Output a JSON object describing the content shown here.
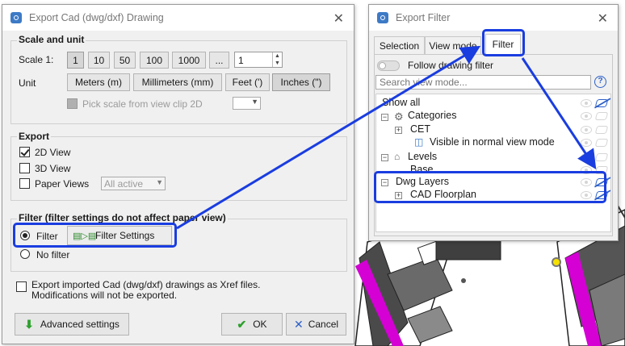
{
  "export_dialog": {
    "title": "Export Cad (dwg/dxf) Drawing",
    "scale_unit": {
      "heading": "Scale and unit",
      "scale_label": "Scale 1:",
      "scale_buttons": [
        "1",
        "10",
        "50",
        "100",
        "1000",
        "..."
      ],
      "scale_value": "1",
      "unit_label": "Unit",
      "unit_buttons": [
        "Meters (m)",
        "Millimeters (mm)",
        "Feet (')",
        "Inches (\")"
      ],
      "selected_unit": "Inches (\")",
      "pick_scale_label": "Pick scale from view clip 2D"
    },
    "export": {
      "heading": "Export",
      "view_2d": "2D View",
      "view_3d": "3D View",
      "paper_views": "Paper Views",
      "paper_views_select": "All active"
    },
    "filter": {
      "heading": "Filter (filter settings do not affect paper view)",
      "filter_option": "Filter",
      "filter_settings": "Filter Settings",
      "no_filter_option": "No filter"
    },
    "xref_line1": "Export imported Cad (dwg/dxf) drawings as Xref files.",
    "xref_line2": "Modifications will not be exported.",
    "advanced_button": "Advanced settings",
    "ok_button": "OK",
    "cancel_button": "Cancel"
  },
  "filter_dialog": {
    "title": "Export Filter",
    "tabs": [
      "Selection",
      "View mode",
      "Filter"
    ],
    "active_tab": "Filter",
    "follow_label": "Follow drawing filter",
    "search_placeholder": "Search view mode...",
    "help": "?",
    "tree": {
      "show_all": "Show all",
      "categories": "Categories",
      "cet": "CET",
      "visible_normal": "Visible in normal view mode",
      "levels": "Levels",
      "base": "Base",
      "dwg_layers": "Dwg Layers",
      "cad_floorplan": "CAD Floorplan"
    }
  },
  "colors": {
    "highlight": "#1a3de0",
    "cad_magenta": "#d400d4",
    "app_icon": "#3d7ac6"
  }
}
